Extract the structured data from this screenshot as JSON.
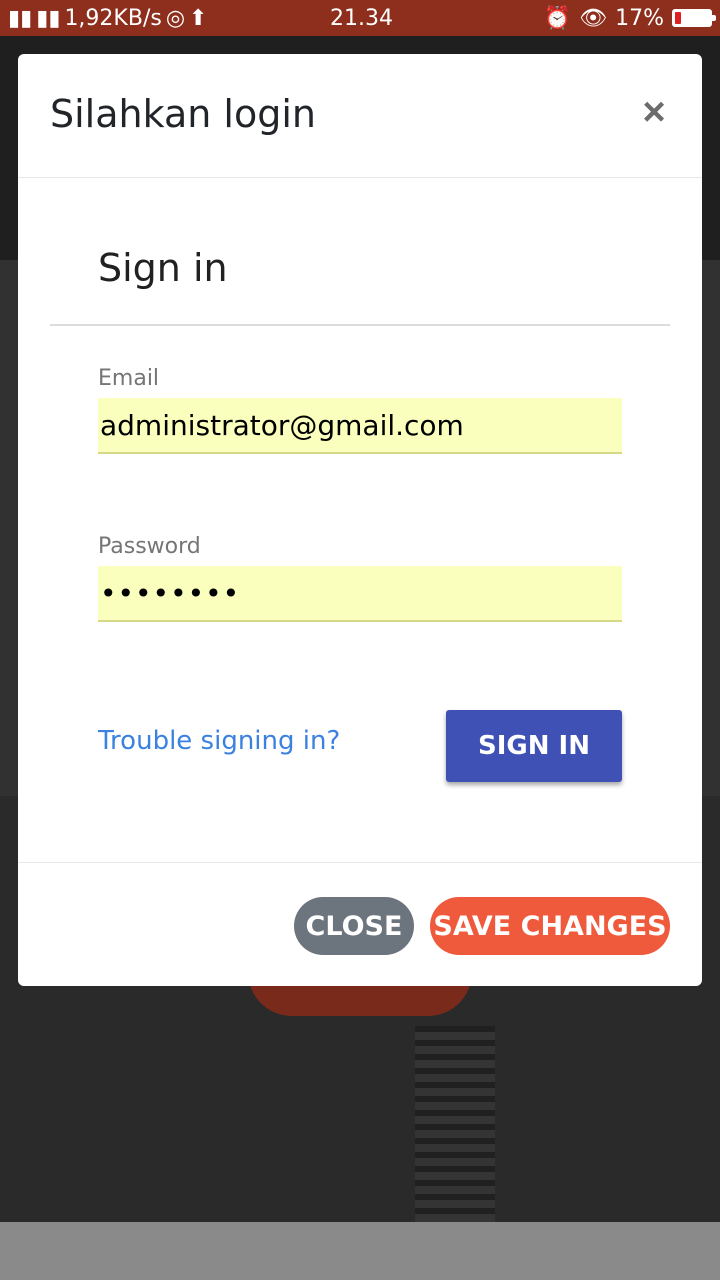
{
  "status_bar": {
    "network_speed": "1,92KB/s",
    "time": "21.34",
    "battery_percent": "17%",
    "battery_level": 0.17,
    "icons": [
      "signal-icon",
      "hplus-signal-icon",
      "whatsapp-icon",
      "upload-icon",
      "alarm-icon",
      "eye-icon",
      "battery-icon"
    ]
  },
  "modal": {
    "title": "Silahkan login",
    "close_icon": "×",
    "signin_title": "Sign in",
    "email": {
      "label": "Email",
      "value": "administrator@gmail.com"
    },
    "password": {
      "label": "Password",
      "value": "••••••••"
    },
    "trouble_link": "Trouble signing in?",
    "signin_button": "SIGN IN",
    "footer": {
      "close_button": "CLOSE",
      "save_button": "SAVE CHANGES"
    }
  },
  "colors": {
    "status_bar": "#8e2e1c",
    "primary_button": "#3f51b5",
    "save_button": "#f05a3c",
    "close_button": "#6c757d",
    "autofill": "#faffbd",
    "link": "#3b82e0"
  }
}
